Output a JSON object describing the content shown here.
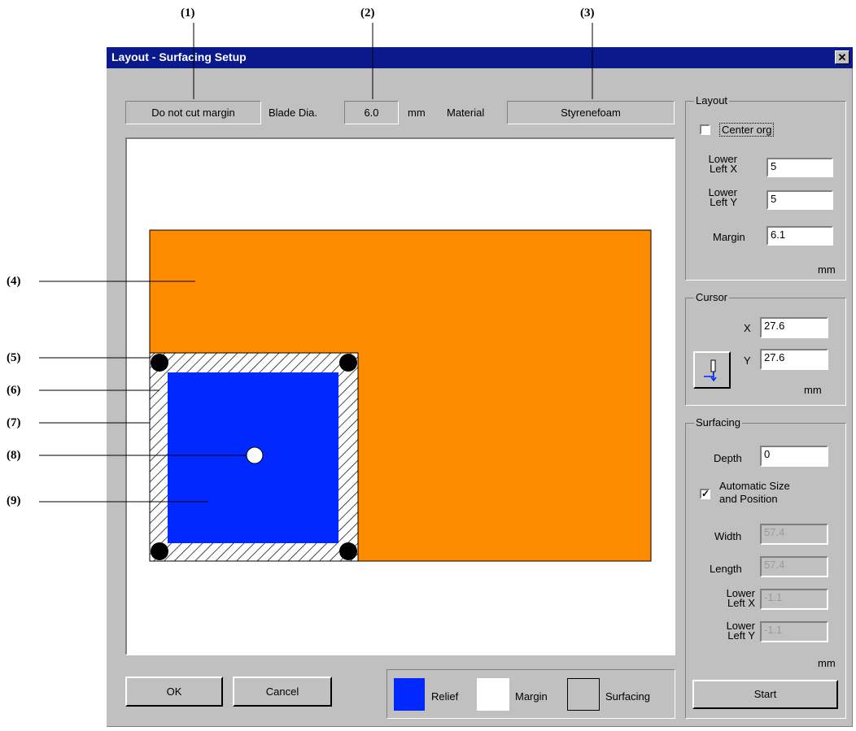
{
  "callouts": {
    "c1": "(1)",
    "c2": "(2)",
    "c3": "(3)",
    "c4": "(4)",
    "c5": "(5)",
    "c6": "(6)",
    "c7": "(7)",
    "c8": "(8)",
    "c9": "(9)"
  },
  "window": {
    "title": "Layout - Surfacing Setup",
    "close_glyph": "✕"
  },
  "top_bar": {
    "margin_mode": "Do not cut margin",
    "blade_label": "Blade Dia.",
    "blade_value": "6.0",
    "blade_unit": "mm",
    "material_label": "Material",
    "material_value": "Styrenefoam"
  },
  "layout_group": {
    "title": "Layout",
    "center_org_label": "Center org",
    "center_org_checked": false,
    "lower_left_x_label_1": "Lower",
    "lower_left_x_label_2": "Left X",
    "lower_left_x": "5",
    "lower_left_y_label_1": "Lower",
    "lower_left_y_label_2": "Left Y",
    "lower_left_y": "5",
    "margin_label": "Margin",
    "margin": "6.1",
    "unit": "mm"
  },
  "cursor_group": {
    "title": "Cursor",
    "x_label": "X",
    "x": "27.6",
    "y_label": "Y",
    "y": "27.6",
    "unit": "mm",
    "tool_icon": "tool-move-icon"
  },
  "surfacing_group": {
    "title": "Surfacing",
    "depth_label": "Depth",
    "depth": "0",
    "auto_label_1": "Automatic Size",
    "auto_label_2": "and Position",
    "auto_checked": true,
    "width_label": "Width",
    "width": "57.4",
    "length_label": "Length",
    "length": "57.4",
    "llx_label_1": "Lower",
    "llx_label_2": "Left X",
    "llx": "-1.1",
    "lly_label_1": "Lower",
    "lly_label_2": "Left Y",
    "lly": "-1.1",
    "unit": "mm",
    "start_label": "Start"
  },
  "buttons": {
    "ok": "OK",
    "cancel": "Cancel"
  },
  "legend": {
    "relief_label": "Relief",
    "margin_label": "Margin",
    "surfacing_label": "Surfacing"
  },
  "colors": {
    "material": "#ff8c00",
    "relief": "#0028ff",
    "titlebar": "#0a1a8c",
    "dialog_bg": "#c0c0c0"
  }
}
